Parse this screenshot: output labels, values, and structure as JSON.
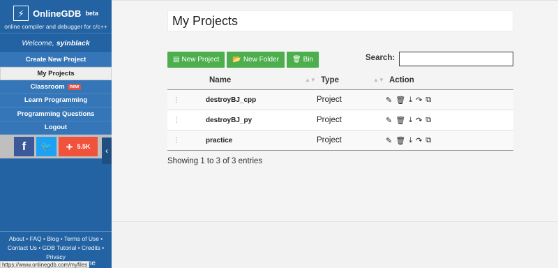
{
  "brand": {
    "name": "OnlineGDB",
    "beta": "beta",
    "tagline": "online compiler and debugger for c/c++",
    "logo_glyph": "⚡"
  },
  "welcome": {
    "prefix": "Welcome,",
    "user": "syinblack"
  },
  "nav": [
    {
      "label": "Create New Project"
    },
    {
      "label": "My Projects",
      "active": true
    },
    {
      "label": "Classroom",
      "badge": "new"
    },
    {
      "label": "Learn Programming"
    },
    {
      "label": "Programming Questions"
    },
    {
      "label": "Logout"
    }
  ],
  "share": {
    "facebook_glyph": "f",
    "twitter_glyph": "🐦",
    "plus_glyph": "+",
    "plus_count": "5.5K"
  },
  "footer": {
    "links_line1": "About • FAQ • Blog • Terms of Use •",
    "links_line2": "Contact Us • GDB Tutorial • Credits •",
    "links_line3": "Privacy",
    "tail": "me"
  },
  "status_url": "https://www.onlinegdb.com/myfiles",
  "page": {
    "title": "My Projects"
  },
  "toolbar": {
    "new_project": "New Project",
    "new_folder": "New Folder",
    "bin": "Bin",
    "search_label": "Search:",
    "search_value": ""
  },
  "table": {
    "headers": {
      "name": "Name",
      "type": "Type",
      "action": "Action"
    },
    "rows": [
      {
        "name": "destroyBJ_cpp",
        "type": "Project"
      },
      {
        "name": "destroyBJ_py",
        "type": "Project"
      },
      {
        "name": "practice",
        "type": "Project"
      }
    ]
  },
  "entries_text": "Showing 1 to 3 of 3 entries",
  "colors": {
    "sidebar": "#2363a3",
    "button_green": "#4cae4c",
    "badge_red": "#d9534f"
  }
}
